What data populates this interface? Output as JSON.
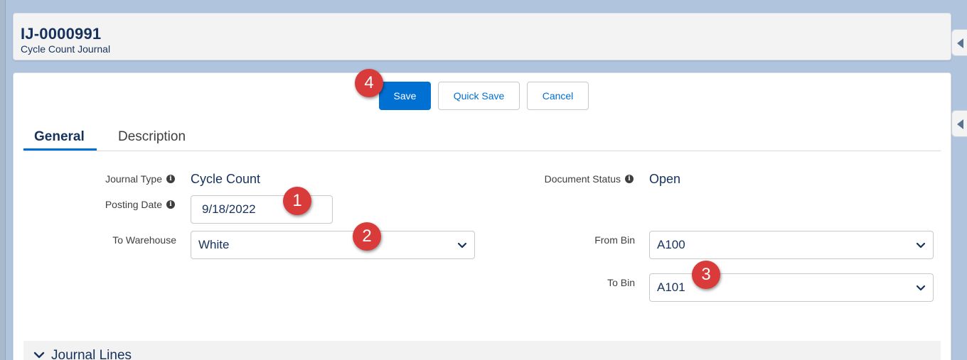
{
  "header": {
    "record_id": "IJ-0000991",
    "record_type": "Cycle Count Journal"
  },
  "actions": {
    "save_label": "Save",
    "quick_save_label": "Quick Save",
    "cancel_label": "Cancel"
  },
  "tabs": [
    {
      "label": "General",
      "active": true
    },
    {
      "label": "Description",
      "active": false
    }
  ],
  "fields": {
    "journal_type": {
      "label": "Journal Type",
      "value": "Cycle Count"
    },
    "posting_date": {
      "label": "Posting Date",
      "value": "9/18/2022"
    },
    "to_warehouse": {
      "label": "To Warehouse",
      "value": "White"
    },
    "document_status": {
      "label": "Document Status",
      "value": "Open"
    },
    "from_bin": {
      "label": "From Bin",
      "value": "A100"
    },
    "to_bin": {
      "label": "To Bin",
      "value": "A101"
    }
  },
  "annotations": {
    "step1": "1",
    "step2": "2",
    "step3": "3",
    "step4": "4"
  },
  "sections": {
    "journal_lines": "Journal Lines"
  },
  "icons": {
    "info": "info-icon",
    "dropdown": "chevron-down-icon",
    "collapse": "chevron-down-icon",
    "panel_toggle": "chevron-left-icon"
  },
  "colors": {
    "primary": "#0070d2",
    "badge": "#d93a3a",
    "text": "#16325c"
  }
}
